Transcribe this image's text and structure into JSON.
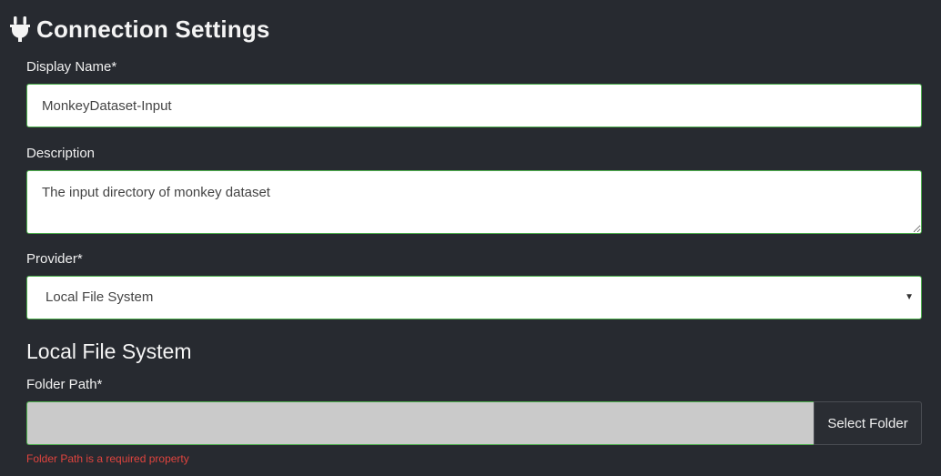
{
  "header": {
    "title": "Connection Settings",
    "icon": "plug-icon"
  },
  "form": {
    "display_name": {
      "label": "Display Name*",
      "value": "MonkeyDataset-Input"
    },
    "description": {
      "label": "Description",
      "value": "The input directory of monkey dataset"
    },
    "provider": {
      "label": "Provider*",
      "selected": "Local File System"
    },
    "section_title": "Local File System",
    "folder_path": {
      "label": "Folder Path*",
      "value": "",
      "button_label": "Select Folder",
      "error": "Folder Path is a required property"
    }
  },
  "colors": {
    "background": "#272a30",
    "valid_border": "#4cae4c",
    "error": "#e0443e"
  }
}
